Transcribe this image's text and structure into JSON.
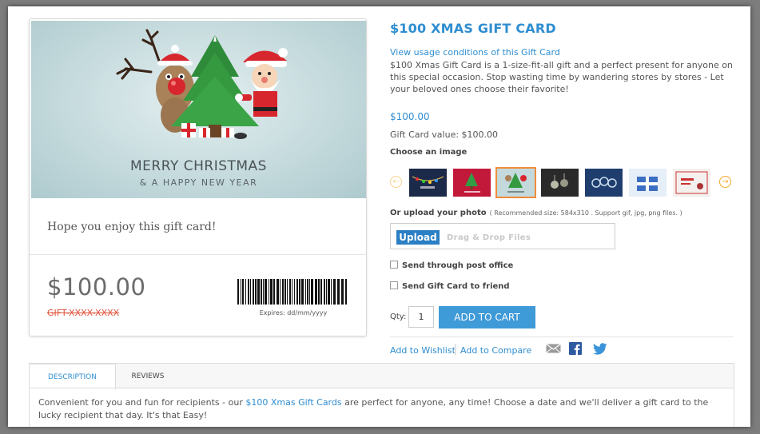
{
  "preview": {
    "image_line1": "MERRY CHRISTMAS",
    "image_line2": "& A HAPPY NEW YEAR",
    "message": "Hope you enjoy this gift card!",
    "price": "$100.00",
    "code": "GIFT-XXXX-XXXX",
    "expires": "Expires: dd/mm/yyyy"
  },
  "product": {
    "title": "$100 XMAS GIFT CARD",
    "usage_link": "View usage conditions of this Gift Card",
    "description": "$100 Xmas Gift Card is a 1-size-fit-all gift and a perfect present for anyone on this special occasion. Stop wasting time by wandering stores by stores - Let your beloved ones choose their favorite!",
    "price": "$100.00",
    "value_text": "Gift Card value: $100.00",
    "choose_image_label": "Choose an image",
    "thumbnails": [
      {
        "name": "garland",
        "bg": "#1c2a4a"
      },
      {
        "name": "red-tree",
        "bg": "#c2183a"
      },
      {
        "name": "reindeer-santa",
        "bg": "#c3d9dc",
        "selected": true
      },
      {
        "name": "dark-ornaments",
        "bg": "#2a2a2a"
      },
      {
        "name": "blue-ornaments",
        "bg": "#1f3e6e"
      },
      {
        "name": "blue-gift",
        "bg": "#e6eef7"
      },
      {
        "name": "happy-birthday",
        "bg": "#f4f0ee"
      }
    ],
    "upload_label": "Or upload your photo",
    "upload_hint": "( Recommended size: 584x310 .  Support gif, jpg, png files. )",
    "upload_button": "Upload",
    "drop_text": "Drag & Drop Files",
    "post_office_label": "Send through post office",
    "send_friend_label": "Send Gift Card to friend",
    "qty_label": "Qty:",
    "qty_value": "1",
    "add_to_cart": "ADD TO CART",
    "wishlist": "Add to Wishlist",
    "compare": "Add to Compare"
  },
  "tabs": {
    "description": "DESCRIPTION",
    "reviews": "REVIEWS",
    "body_prefix": "Convenient for you and fun for recipients - our ",
    "body_link": "$100 Xmas Gift Cards",
    "body_suffix": " are perfect for anyone, any time! Choose a date and we'll deliver a gift card to the lucky recipient that day. It's that Easy!"
  },
  "colors": {
    "accent": "#2f8ed0",
    "button": "#3f9ad8",
    "code_red": "#e0533d",
    "selected_border": "#f08c3a"
  }
}
